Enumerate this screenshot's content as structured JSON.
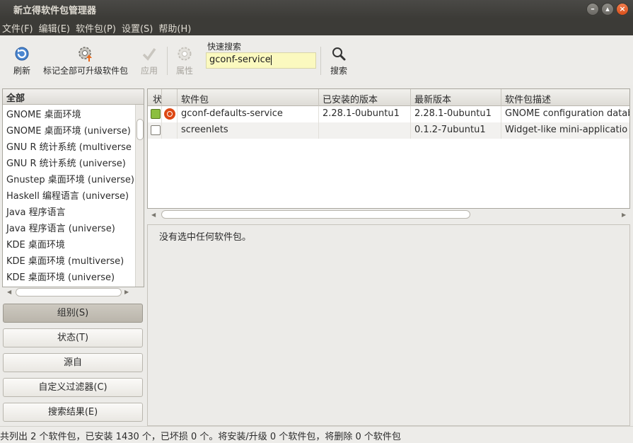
{
  "window": {
    "title": "新立得软件包管理器",
    "controls": [
      "minimize",
      "maximize",
      "close"
    ]
  },
  "menubar": [
    "文件(F)",
    "编辑(E)",
    "软件包(P)",
    "设置(S)",
    "帮助(H)"
  ],
  "toolbar": {
    "reload": "刷新",
    "mark_upgrades": "标记全部可升级软件包",
    "apply": "应用",
    "properties": "属性",
    "quick_search_label": "快速搜索",
    "quick_search_value": "gconf-service",
    "search": "搜索"
  },
  "sections": {
    "header": "全部",
    "items": [
      "GNOME 桌面环境",
      "GNOME 桌面环境 (universe)",
      "GNU R 统计系统 (multiverse",
      "GNU R 统计系统 (universe)",
      "Gnustep 桌面环境 (universe)",
      "Haskell 编程语言 (universe)",
      "Java 程序语言",
      "Java 程序语言 (universe)",
      "KDE 桌面环境",
      "KDE 桌面环境 (multiverse)",
      "KDE 桌面环境 (universe)"
    ]
  },
  "filter_buttons": {
    "sections": "组别(S)",
    "status": "状态(T)",
    "origin": "源自",
    "custom": "自定义过滤器(C)",
    "search_results": "搜索结果(E)"
  },
  "package_table": {
    "columns": [
      "状",
      "",
      "软件包",
      "已安装的版本",
      "最新版本",
      "软件包描述"
    ],
    "rows": [
      {
        "status": "installed",
        "supported": true,
        "name": "gconf-defaults-service",
        "installed_version": "2.28.1-0ubuntu1",
        "latest_version": "2.28.1-0ubuntu1",
        "description": "GNOME configuration datab"
      },
      {
        "status": "not-installed",
        "supported": false,
        "name": "screenlets",
        "installed_version": "",
        "latest_version": "0.1.2-7ubuntu1",
        "description": "Widget-like mini-applicatio"
      }
    ]
  },
  "details": {
    "text": "没有选中任何软件包。"
  },
  "statusbar": {
    "text": "共列出 2 个软件包，已安装 1430 个，已坏损 0 个。将安装/升级 0 个软件包，将删除 0 个软件包"
  },
  "colors": {
    "titlebar": "#3c3b37",
    "installed": "#8cbf3f",
    "ubuntu": "#dd4814",
    "search_bg": "#fbf9bf"
  }
}
